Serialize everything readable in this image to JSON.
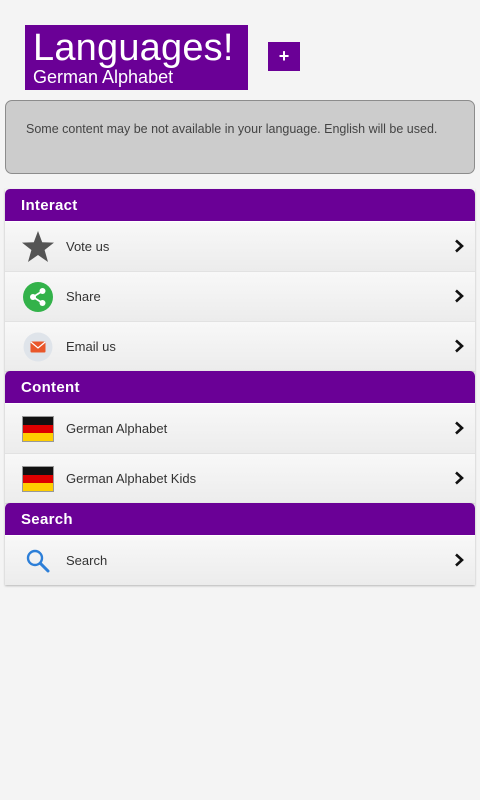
{
  "header": {
    "title": "Languages!",
    "subtitle": "German Alphabet",
    "add_button_label": "+"
  },
  "notice": {
    "text": "Some content may be not available in your language. English will be used."
  },
  "sections": [
    {
      "title": "Interact",
      "items": [
        {
          "label": "Vote us",
          "icon": "star-icon"
        },
        {
          "label": "Share",
          "icon": "share-icon"
        },
        {
          "label": "Email us",
          "icon": "email-icon"
        }
      ]
    },
    {
      "title": "Content",
      "items": [
        {
          "label": "German Alphabet",
          "icon": "german-flag-icon"
        },
        {
          "label": "German Alphabet Kids",
          "icon": "german-flag-icon"
        }
      ]
    },
    {
      "title": "Search",
      "items": [
        {
          "label": "Search",
          "icon": "search-icon"
        }
      ]
    }
  ],
  "colors": {
    "accent": "#6a0096",
    "notice_bg": "#cccccc",
    "share_green": "#33b24a",
    "email_orange": "#e9572b",
    "search_blue": "#2d7fd8"
  }
}
